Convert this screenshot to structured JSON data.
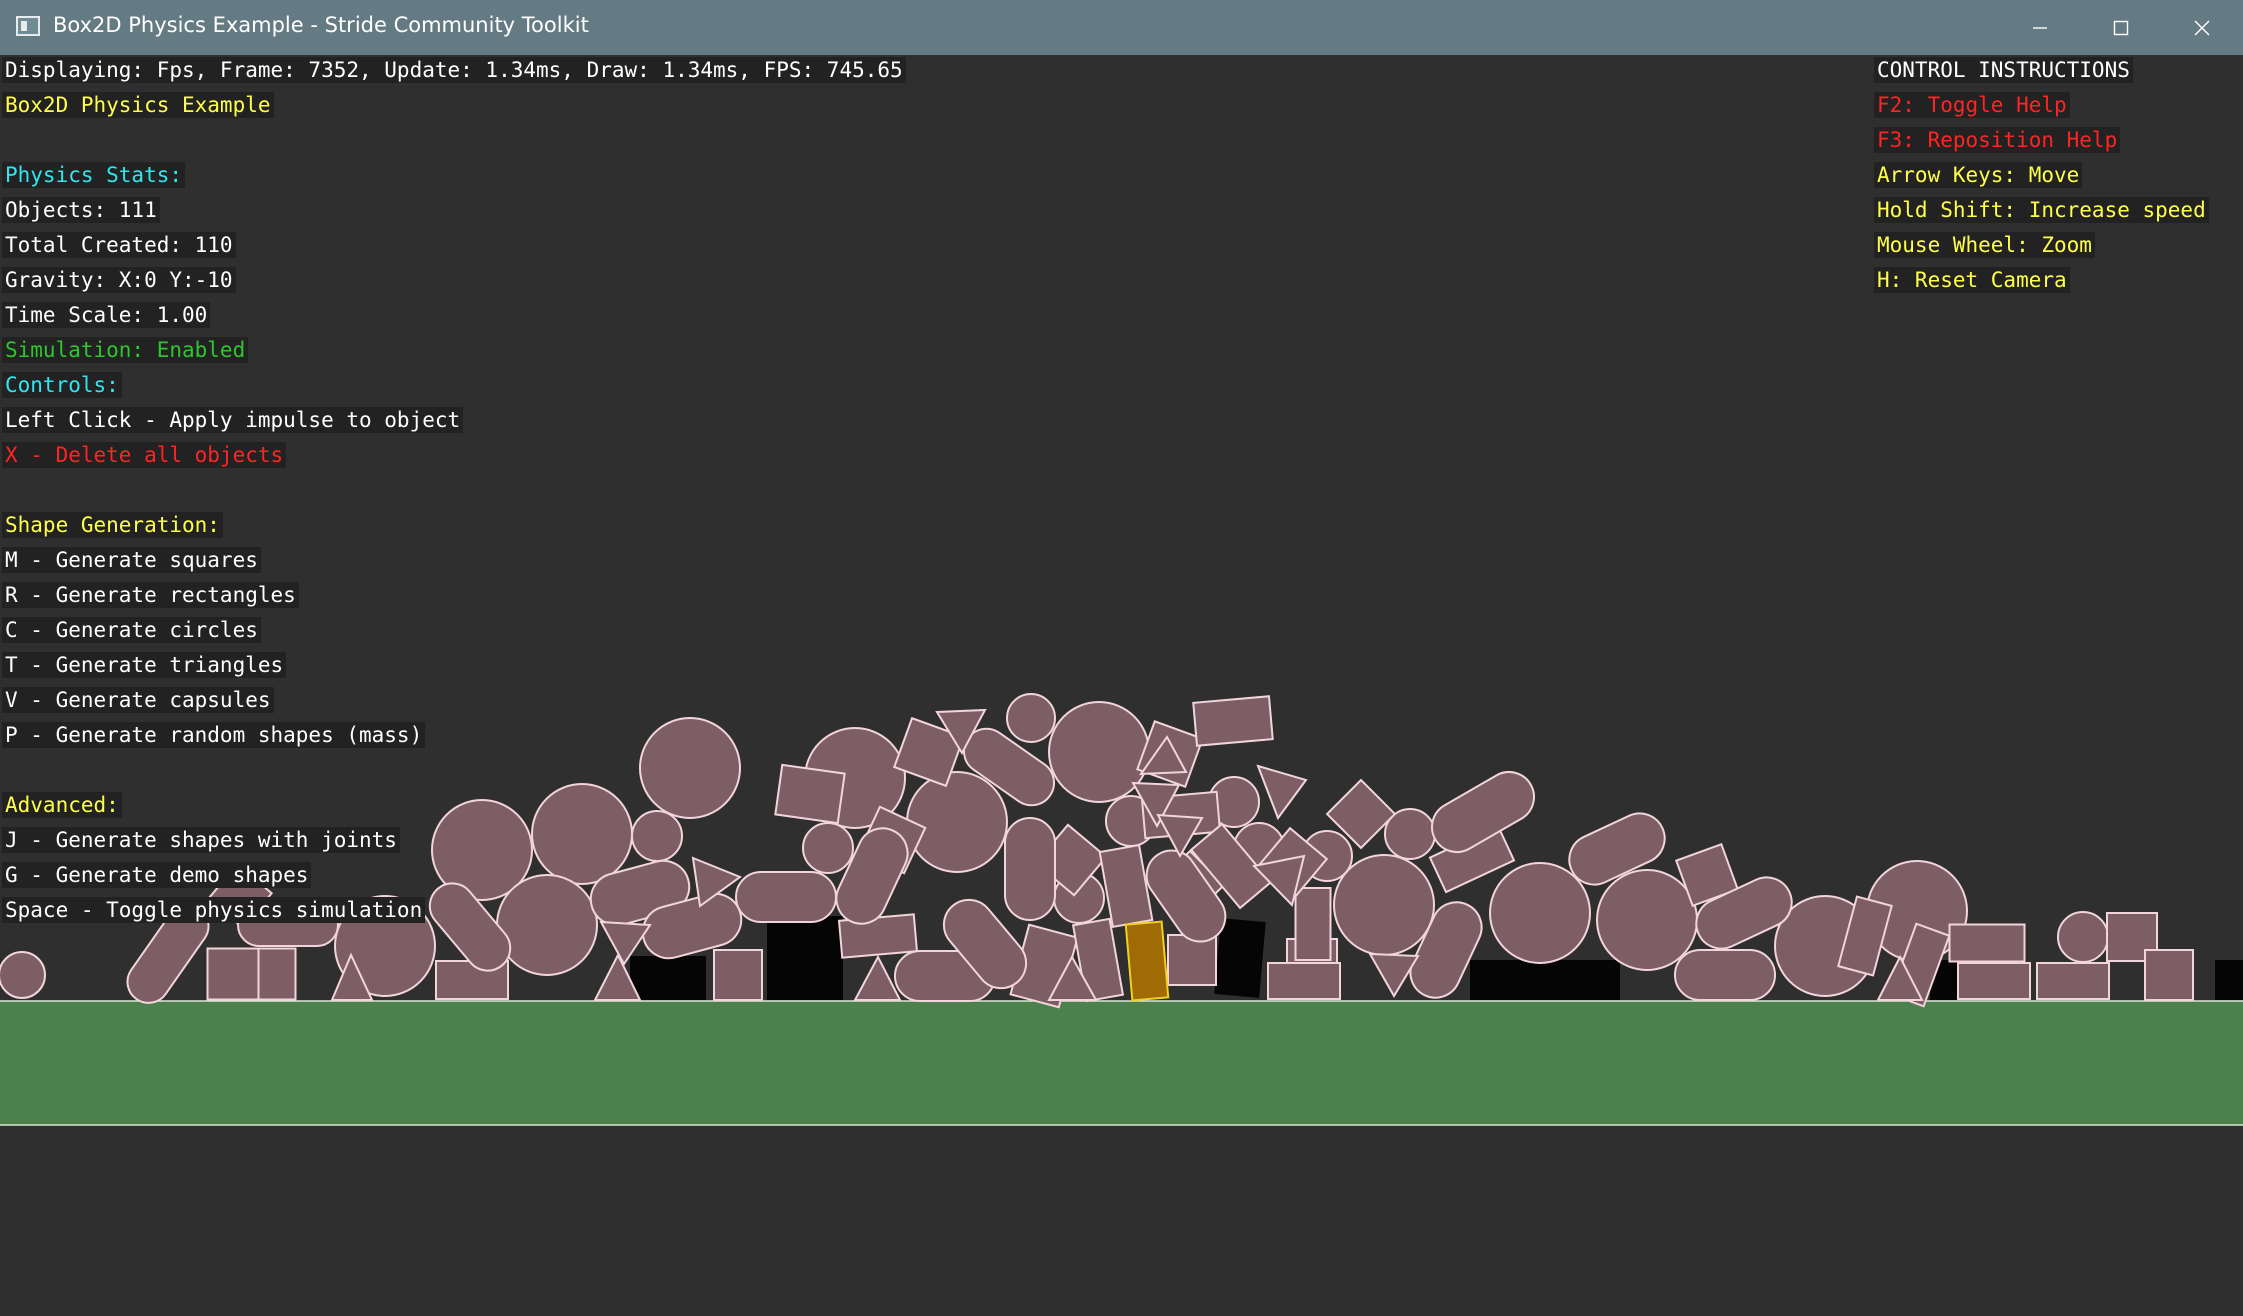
{
  "window": {
    "title": "Box2D Physics Example - Stride Community Toolkit",
    "controls": {
      "minimize_icon": "minimize-icon",
      "maximize_icon": "maximize-icon",
      "close_icon": "close-icon"
    }
  },
  "colors": {
    "white": "#ffffff",
    "yellow": "#ffff4a",
    "cyan": "#32e6f0",
    "green": "#2fc52f",
    "red": "#ff2424",
    "shape_fill": "#7e5e65",
    "shape_outline": "#f2d5dc",
    "ground": "#4c804c",
    "selected_fill": "#a06a04",
    "selected_outline": "#f0d020"
  },
  "hud_left": [
    {
      "text": "Displaying: Fps, Frame: 7352, Update: 1.34ms, Draw: 1.34ms, FPS: 745.65",
      "color": "white"
    },
    {
      "text": "Box2D Physics Example",
      "color": "yellow"
    },
    {
      "text": "",
      "color": "white"
    },
    {
      "text": "Physics Stats:",
      "color": "cyan"
    },
    {
      "text": "Objects: 111",
      "color": "white"
    },
    {
      "text": "Total Created: 110",
      "color": "white"
    },
    {
      "text": "Gravity: X:0 Y:-10",
      "color": "white"
    },
    {
      "text": "Time Scale: 1.00",
      "color": "white"
    },
    {
      "text": "Simulation: Enabled",
      "color": "green"
    },
    {
      "text": "Controls:",
      "color": "cyan"
    },
    {
      "text": "Left Click - Apply impulse to object",
      "color": "white"
    },
    {
      "text": "X - Delete all objects",
      "color": "red"
    },
    {
      "text": "",
      "color": "white"
    },
    {
      "text": "Shape Generation:",
      "color": "yellow"
    },
    {
      "text": "M - Generate squares",
      "color": "white"
    },
    {
      "text": "R - Generate rectangles",
      "color": "white"
    },
    {
      "text": "C - Generate circles",
      "color": "white"
    },
    {
      "text": "T - Generate triangles",
      "color": "white"
    },
    {
      "text": "V - Generate capsules",
      "color": "white"
    },
    {
      "text": "P - Generate random shapes (mass)",
      "color": "white"
    },
    {
      "text": "",
      "color": "white"
    },
    {
      "text": "Advanced:",
      "color": "yellow"
    },
    {
      "text": "J - Generate shapes with joints",
      "color": "white"
    },
    {
      "text": "G - Generate demo shapes",
      "color": "white"
    },
    {
      "text": "Space - Toggle physics simulation",
      "color": "white"
    }
  ],
  "hud_right": [
    {
      "text": "CONTROL INSTRUCTIONS",
      "color": "white"
    },
    {
      "text": "F2: Toggle Help",
      "color": "red"
    },
    {
      "text": "F3: Reposition Help",
      "color": "red"
    },
    {
      "text": "Arrow Keys: Move",
      "color": "yellow"
    },
    {
      "text": "Hold Shift: Increase speed",
      "color": "yellow"
    },
    {
      "text": "Mouse Wheel: Zoom",
      "color": "yellow"
    },
    {
      "text": "H: Reset Camera",
      "color": "yellow"
    }
  ]
}
